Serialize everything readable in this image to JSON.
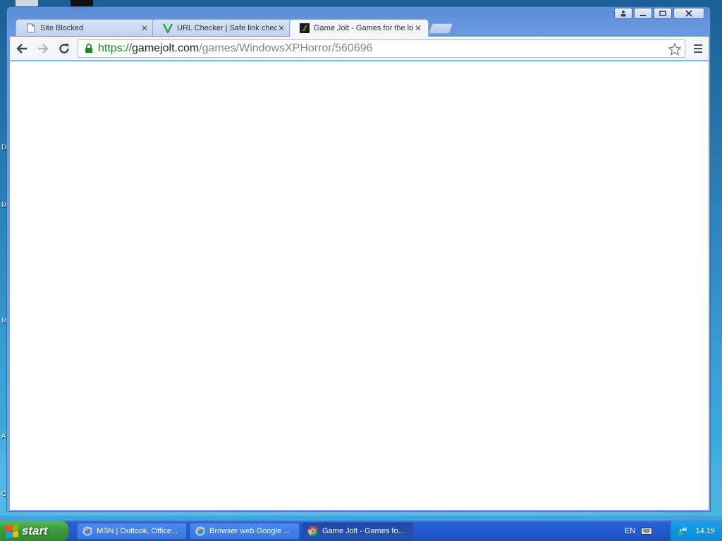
{
  "desktop": {
    "side_letters": [
      "D",
      "M",
      "M",
      "A",
      "C"
    ]
  },
  "browser": {
    "tabs": [
      {
        "title": "Site Blocked",
        "icon": "page-icon",
        "active": false
      },
      {
        "title": "URL Checker | Safe link chec",
        "icon": "v-logo-icon",
        "active": false
      },
      {
        "title": "Game Jolt - Games for the lo",
        "icon": "gamejolt-icon",
        "active": true
      }
    ],
    "url": {
      "scheme": "https://",
      "host": "gamejolt.com",
      "path": "/games/WindowsXPHorror/560696"
    }
  },
  "taskbar": {
    "start_label": "start",
    "items": [
      {
        "label": "MSN | Outlook, Office...",
        "icon": "ie-icon",
        "active": false
      },
      {
        "label": "Browser web Google ...",
        "icon": "ie-icon",
        "active": false
      },
      {
        "label": "Game Jolt - Games fo...",
        "icon": "chrome-icon",
        "active": true
      }
    ],
    "language": "EN",
    "clock": "14.19"
  },
  "colors": {
    "url_scheme": "#1a8a1a",
    "taskbar": "#245bd1",
    "start": "#3a9a3a"
  }
}
